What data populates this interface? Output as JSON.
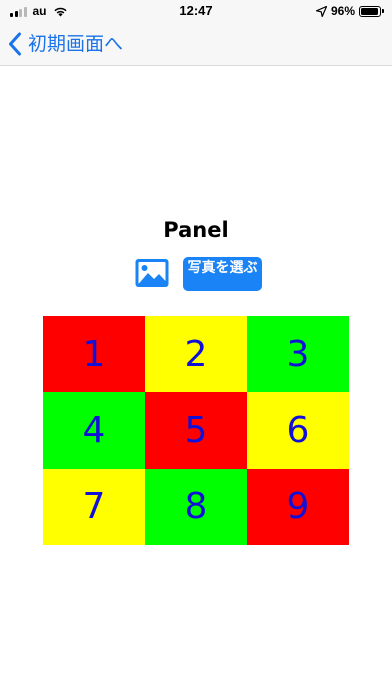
{
  "status_bar": {
    "carrier": "au",
    "time": "12:47",
    "battery_percent": "96%",
    "battery_level": 0.96,
    "icons": [
      "signal-icon",
      "wifi-icon",
      "location-arrow-icon",
      "battery-icon"
    ]
  },
  "nav": {
    "back_label": "初期画面へ",
    "back_icon": "chevron-left-icon"
  },
  "main": {
    "title": "Panel",
    "photo_icon": "photo-icon",
    "choose_photo_label": "写真を選ぶ"
  },
  "grid": {
    "tiles": [
      {
        "label": "1",
        "color": "#ff0000"
      },
      {
        "label": "2",
        "color": "#ffff00"
      },
      {
        "label": "3",
        "color": "#00ff00"
      },
      {
        "label": "4",
        "color": "#00ff00"
      },
      {
        "label": "5",
        "color": "#ff0000"
      },
      {
        "label": "6",
        "color": "#ffff00"
      },
      {
        "label": "7",
        "color": "#ffff00"
      },
      {
        "label": "8",
        "color": "#00ff00"
      },
      {
        "label": "9",
        "color": "#ff0000"
      }
    ],
    "number_color": "#1010d8"
  },
  "colors": {
    "accent": "#1a73e8",
    "button": "#1a83f6"
  }
}
